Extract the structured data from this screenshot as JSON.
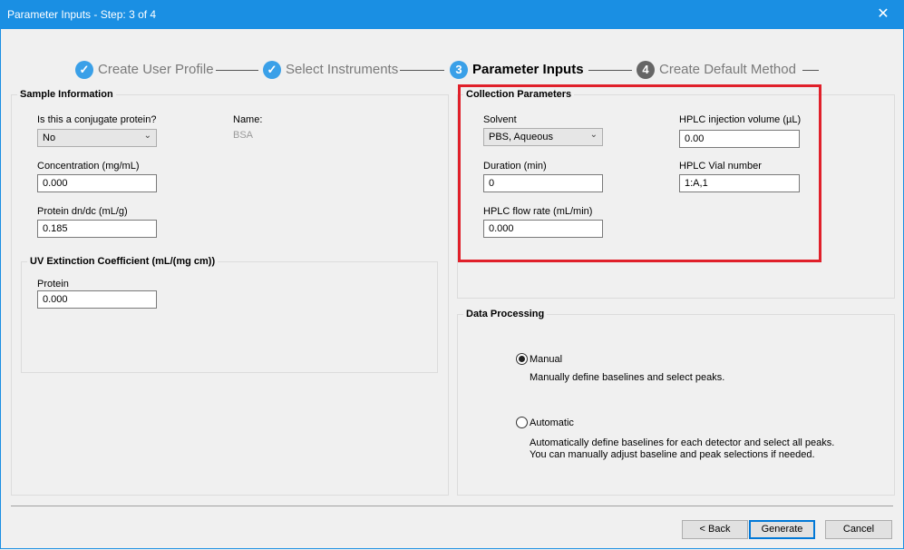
{
  "window": {
    "title": "Parameter Inputs - Step: 3 of 4",
    "close_glyph": "✕"
  },
  "steps": [
    {
      "num": "✓",
      "label": "Create User Profile"
    },
    {
      "num": "✓",
      "label": "Select Instruments"
    },
    {
      "num": "3",
      "label": "Parameter Inputs"
    },
    {
      "num": "4",
      "label": "Create Default Method"
    }
  ],
  "sample": {
    "title": "Sample Information",
    "conjugate_label": "Is this a conjugate protein?",
    "conjugate_value": "No",
    "name_label": "Name:",
    "name_value": "BSA",
    "concentration_label": "Concentration (mg/mL)",
    "concentration_value": "0.000",
    "dndc_label": "Protein dn/dc (mL/g)",
    "dndc_value": "0.185"
  },
  "uv": {
    "title": "UV Extinction Coefficient (mL/(mg cm))",
    "protein_label": "Protein",
    "protein_value": "0.000"
  },
  "collection": {
    "title": "Collection Parameters",
    "solvent_label": "Solvent",
    "solvent_value": "PBS, Aqueous",
    "duration_label": "Duration (min)",
    "duration_value": "0",
    "flow_label": "HPLC flow rate (mL/min)",
    "flow_value": "0.000",
    "injection_label": "HPLC injection volume (µL)",
    "injection_value": "0.00",
    "vial_label": "HPLC Vial number",
    "vial_value": "1:A,1"
  },
  "processing": {
    "title": "Data Processing",
    "manual_label": "Manual",
    "manual_desc": "Manually define baselines and select peaks.",
    "automatic_label": "Automatic",
    "automatic_desc1": "Automatically define baselines for each detector and select all peaks.",
    "automatic_desc2": "You can manually adjust baseline and peak selections if needed.",
    "selected": "Manual"
  },
  "buttons": {
    "back": "< Back",
    "generate": "Generate",
    "cancel": "Cancel"
  }
}
